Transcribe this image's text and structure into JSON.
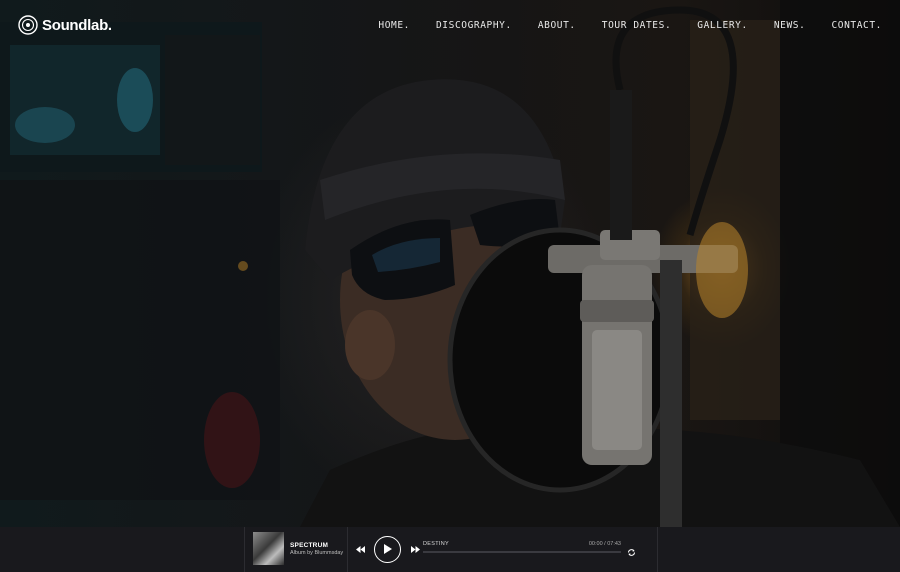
{
  "brand": {
    "name": "Soundlab."
  },
  "nav": {
    "items": [
      {
        "label": "HOME."
      },
      {
        "label": "DISCOGRAPHY."
      },
      {
        "label": "ABOUT."
      },
      {
        "label": "TOUR DATES."
      },
      {
        "label": "GALLERY."
      },
      {
        "label": "NEWS."
      },
      {
        "label": "CONTACT."
      }
    ]
  },
  "player": {
    "album_title": "SPECTRUM",
    "album_sub": "Album by Blummsday",
    "now_playing": "DESTINY",
    "time": "00:00 / 07:43",
    "progress": 0,
    "icons": {
      "prev": "rewind-icon",
      "play": "play-icon",
      "next": "fast-forward-icon",
      "repeat": "repeat-icon"
    }
  },
  "colors": {
    "player_bg": "#19191d",
    "text": "#ffffff",
    "lamp_glow": "#be8228"
  }
}
